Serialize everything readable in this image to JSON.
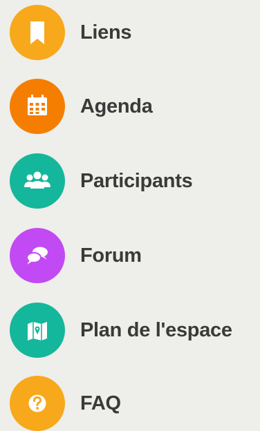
{
  "menu": {
    "items": [
      {
        "label": "Liens",
        "icon": "bookmark-icon",
        "color": "#f7a81b"
      },
      {
        "label": "Agenda",
        "icon": "calendar-icon",
        "color": "#f57e00"
      },
      {
        "label": "Participants",
        "icon": "people-icon",
        "color": "#14b79b"
      },
      {
        "label": "Forum",
        "icon": "chat-bubbles-icon",
        "color": "#c24af4"
      },
      {
        "label": "Plan de l'espace",
        "icon": "map-icon",
        "color": "#14b79b"
      },
      {
        "label": "FAQ",
        "icon": "question-icon",
        "color": "#f7a81b"
      }
    ]
  }
}
